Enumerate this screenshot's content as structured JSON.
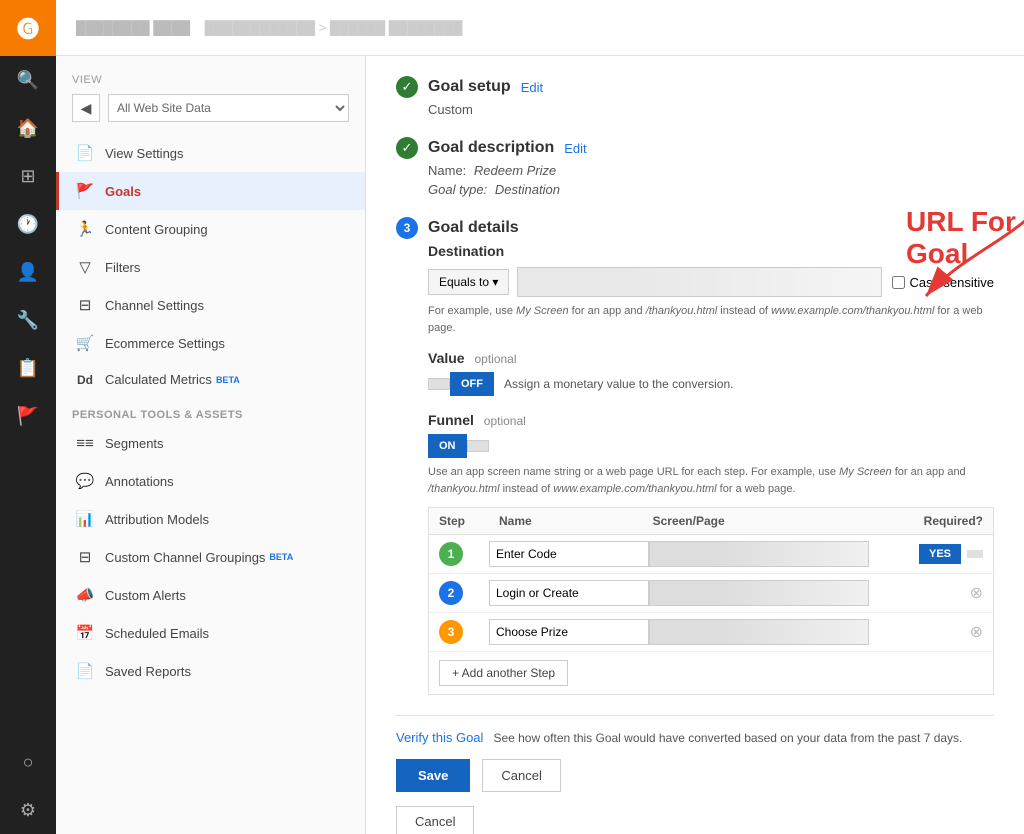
{
  "nav": {
    "logo": "G",
    "items": [
      {
        "id": "search",
        "icon": "🔍",
        "label": "search-icon"
      },
      {
        "id": "home",
        "icon": "🏠",
        "label": "home-icon"
      },
      {
        "id": "grid",
        "icon": "⊞",
        "label": "grid-icon"
      },
      {
        "id": "clock",
        "icon": "🕐",
        "label": "clock-icon"
      },
      {
        "id": "person",
        "icon": "👤",
        "label": "person-icon"
      },
      {
        "id": "tools",
        "icon": "⚙",
        "label": "tools-icon"
      },
      {
        "id": "report",
        "icon": "📄",
        "label": "report-icon"
      },
      {
        "id": "flag",
        "icon": "🚩",
        "label": "flag-icon"
      }
    ],
    "bottom_items": [
      {
        "id": "circle",
        "icon": "○",
        "label": "info-icon"
      },
      {
        "id": "gear",
        "icon": "⚙",
        "label": "settings-icon"
      }
    ]
  },
  "topbar": {
    "title": "Account Name",
    "subtitle": "Property Name > View Name"
  },
  "sidebar": {
    "view_label": "VIEW",
    "select_placeholder": "All Web Site Data",
    "items": [
      {
        "id": "view-settings",
        "icon": "📄",
        "label": "View Settings"
      },
      {
        "id": "goals",
        "icon": "🚩",
        "label": "Goals",
        "active": true
      },
      {
        "id": "content-grouping",
        "icon": "🏃",
        "label": "Content Grouping"
      },
      {
        "id": "filters",
        "icon": "▽",
        "label": "Filters"
      },
      {
        "id": "channel-settings",
        "icon": "⊟",
        "label": "Channel Settings"
      },
      {
        "id": "ecommerce-settings",
        "icon": "🛒",
        "label": "Ecommerce Settings"
      },
      {
        "id": "calculated-metrics",
        "icon": "Dd",
        "label": "Calculated Metrics",
        "beta": true
      }
    ],
    "personal_tools_label": "PERSONAL TOOLS & ASSETS",
    "personal_items": [
      {
        "id": "segments",
        "icon": "≡",
        "label": "Segments"
      },
      {
        "id": "annotations",
        "icon": "💬",
        "label": "Annotations"
      },
      {
        "id": "attribution-models",
        "icon": "📊",
        "label": "Attribution Models"
      },
      {
        "id": "custom-channel-groupings",
        "icon": "⊟",
        "label": "Custom Channel Groupings",
        "beta": true
      },
      {
        "id": "custom-alerts",
        "icon": "📣",
        "label": "Custom Alerts"
      },
      {
        "id": "scheduled-emails",
        "icon": "📅",
        "label": "Scheduled Emails"
      },
      {
        "id": "saved-reports",
        "icon": "📄",
        "label": "Saved Reports"
      }
    ]
  },
  "main": {
    "url_goal_label": "URL For Goal",
    "goal_setup": {
      "title": "Goal setup",
      "edit_label": "Edit",
      "sub": "Custom"
    },
    "goal_description": {
      "title": "Goal description",
      "edit_label": "Edit",
      "name_label": "Name:",
      "name_value": "Redeem Prize",
      "type_label": "Goal type:",
      "type_value": "Destination"
    },
    "goal_details": {
      "title": "Goal details",
      "step_number": "3",
      "destination_label": "Destination",
      "equals_to": "Equals to ▾",
      "destination_input_placeholder": "",
      "case_sensitive_label": "Case sensitive",
      "hint": "For example, use My Screen for an app and /thankyou.html instead of www.example.com/thankyou.html for a web page.",
      "value_label": "Value",
      "optional_label": "optional",
      "toggle_off": "OFF",
      "toggle_on": "ON",
      "assign_text": "Assign a monetary value to the conversion.",
      "funnel_label": "Funnel",
      "funnel_hint": "Use an app screen name string or a web page URL for each step. For example, use My Screen for an app and /thankyou.html instead of www.example.com/thankyou.html for a web page.",
      "funnel_table": {
        "headers": [
          "Step",
          "Name",
          "Screen/Page",
          "Required?"
        ],
        "rows": [
          {
            "step": "1",
            "name": "Enter Code",
            "screen": "",
            "required": true
          },
          {
            "step": "2",
            "name": "Login or Create",
            "screen": "",
            "required": false
          },
          {
            "step": "3",
            "name": "Choose Prize",
            "screen": "",
            "required": false
          }
        ]
      },
      "add_step_label": "+ Add another Step"
    },
    "verify_label": "Verify this Goal",
    "verify_text": "See how often this Goal would have converted based on your data from the past 7 days.",
    "save_label": "Save",
    "cancel_label": "Cancel",
    "bottom_cancel_label": "Cancel"
  }
}
